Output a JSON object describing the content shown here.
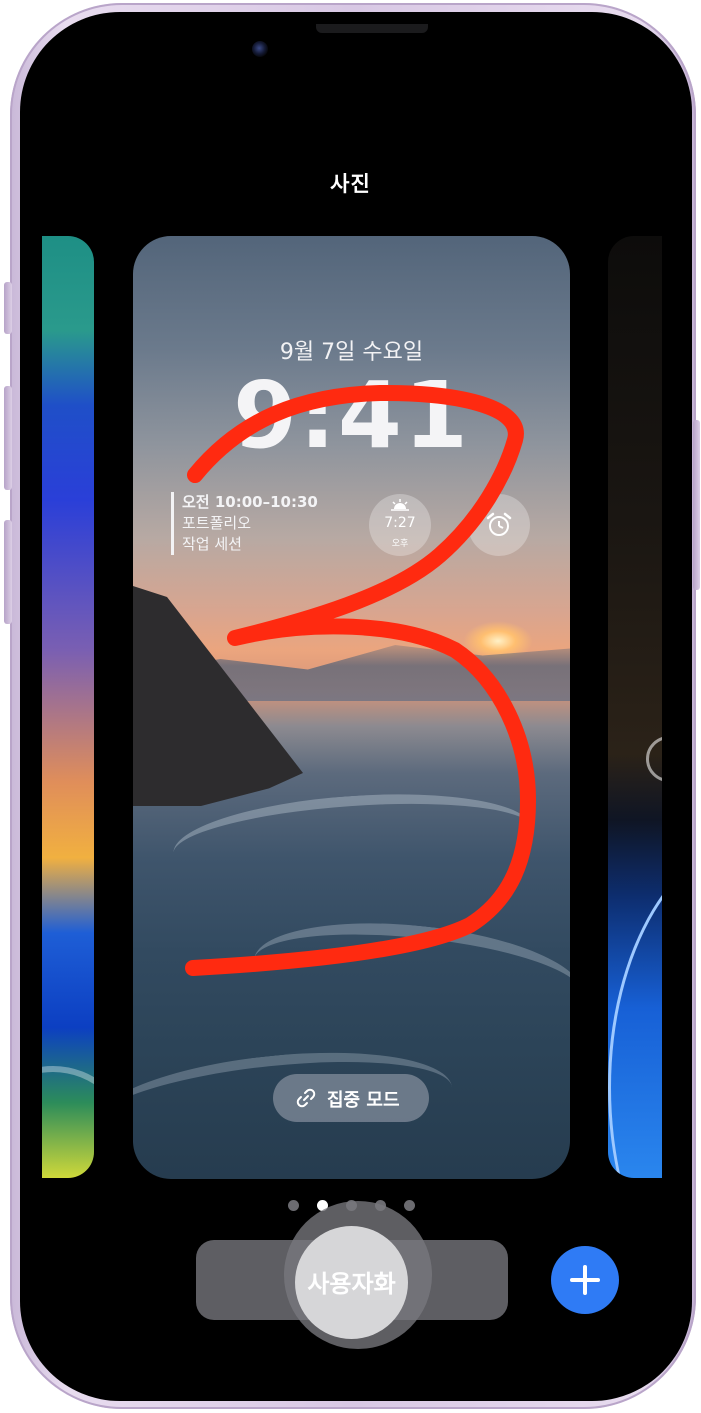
{
  "screen": {
    "title": "사진"
  },
  "lock_screen": {
    "date": "9월 7일 수요일",
    "time": "9:41",
    "calendar_widget": {
      "time_range": "오전 10:00–10:30",
      "line1": "포트폴리오",
      "line2": "작업 세션"
    },
    "sunset_widget": {
      "time": "7:27",
      "period": "오후",
      "icon": "sunset-icon"
    },
    "alarm_widget": {
      "icon": "alarm-clock-icon"
    },
    "focus_button": {
      "label": "집중 모드",
      "icon": "link-icon"
    }
  },
  "pager": {
    "count": 5,
    "active_index": 1
  },
  "controls": {
    "customize_label": "사용자화",
    "add_icon": "plus-icon"
  },
  "colors": {
    "accent": "#2f7bf5",
    "annotation": "#ff2a10",
    "frame": "#d8c8e4"
  }
}
